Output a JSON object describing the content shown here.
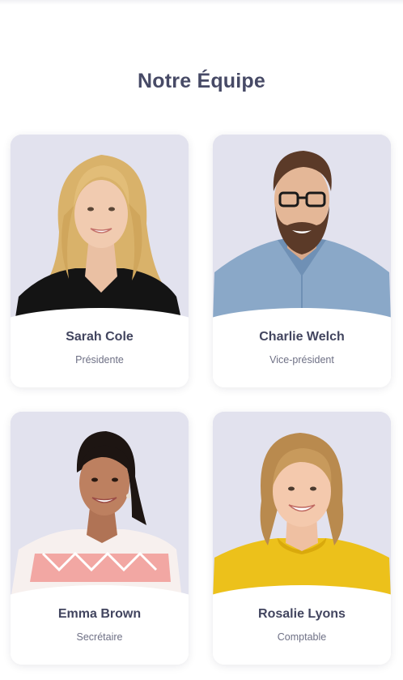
{
  "section": {
    "title": "Notre Équipe"
  },
  "team": [
    {
      "name": "Sarah Cole",
      "role": "Présidente",
      "photo": "woman-blonde-black-top-photo"
    },
    {
      "name": "Charlie Welch",
      "role": "Vice-président",
      "photo": "man-beard-glasses-denim-shirt-photo"
    },
    {
      "name": "Emma Brown",
      "role": "Secrétaire",
      "photo": "woman-dark-hair-pink-pattern-top-photo"
    },
    {
      "name": "Rosalie Lyons",
      "role": "Comptable",
      "photo": "woman-blonde-yellow-top-photo"
    }
  ],
  "colors": {
    "title": "#474a66",
    "photo_bg": "#e2e2ee",
    "card_bg": "#ffffff"
  }
}
